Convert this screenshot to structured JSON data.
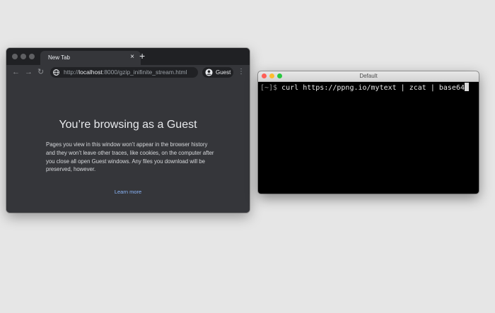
{
  "browser": {
    "tab_title": "New Tab",
    "tab_close": "×",
    "new_tab": "+",
    "nav": {
      "back": "←",
      "forward": "→",
      "reload": "↻"
    },
    "url_scheme": "http://",
    "url_host": "localhost",
    "url_rest": ":8000/gzip_inifinite_stream.html",
    "guest_label": "Guest",
    "menu": "⋮",
    "page": {
      "title": "You’re browsing as a Guest",
      "description": "Pages you view in this window won’t appear in the browser history and they won’t leave other traces, like cookies, on the computer after you close all open Guest windows. Any files you download will be preserved, however.",
      "learn_more": "Learn more"
    }
  },
  "terminal": {
    "title": "Default",
    "prompt": "[~]$ ",
    "command": "curl https://ppng.io/mytext | zcat | base64"
  },
  "colors": {
    "desktop": "#e6e6e6",
    "browser_frame": "#202124",
    "browser_page": "#35363a",
    "link": "#8ab4f8",
    "terminal_bg": "#000000",
    "traffic_red": "#ff5f57",
    "traffic_yellow": "#febc2e",
    "traffic_green": "#28c840"
  }
}
